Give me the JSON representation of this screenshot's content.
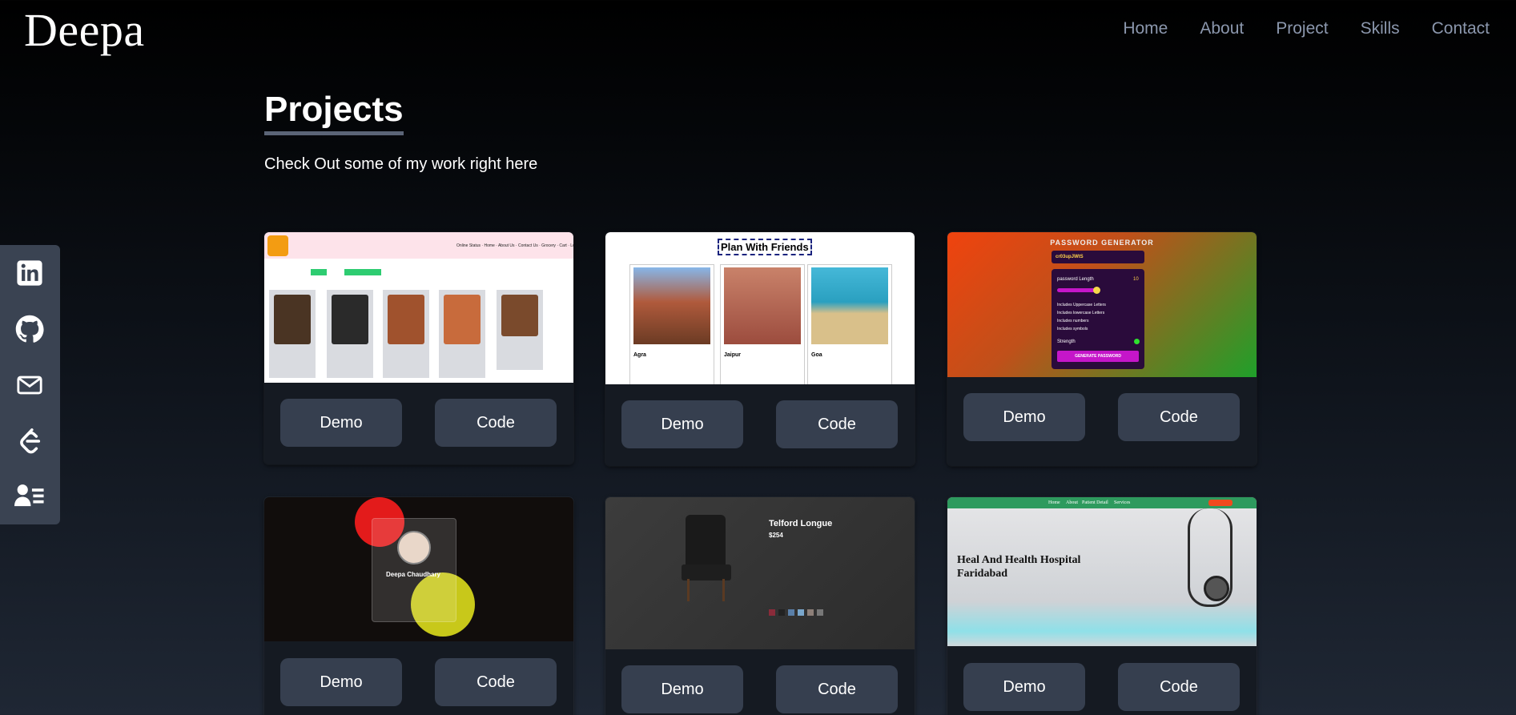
{
  "header": {
    "logo": "Deepa",
    "nav": [
      "Home",
      "About",
      "Project",
      "Skills",
      "Contact"
    ]
  },
  "page": {
    "title": "Projects",
    "subtitle": "Check Out some of my work right here"
  },
  "social_icons": [
    "linkedin-icon",
    "github-icon",
    "mail-icon",
    "leetcode-icon",
    "resume-icon"
  ],
  "projects": [
    {
      "name": "food-delivery",
      "demo": "Demo",
      "code": "Code"
    },
    {
      "name": "plan-with-friends",
      "demo": "Demo",
      "code": "Code",
      "shot_title": "Plan With Friends",
      "cities": [
        "Agra",
        "Jaipur",
        "Goa"
      ]
    },
    {
      "name": "password-generator",
      "demo": "Demo",
      "code": "Code",
      "shot_title": "PASSWORD GENERATOR",
      "password": "cr03upJWtS",
      "length_label": "password Length",
      "length_value": "10",
      "options": [
        "Includes Uppercase Letters",
        "Includes lowercase Letters",
        "Includes numbers",
        "Includes symbols"
      ],
      "strength": "Strength",
      "generate": "GENERATE PASSWORD"
    },
    {
      "name": "profile-card",
      "demo": "Demo",
      "code": "Code",
      "person": "Deepa Chaudhary"
    },
    {
      "name": "product-page",
      "demo": "Demo",
      "code": "Code",
      "product": "Telford Longue",
      "price": "$254"
    },
    {
      "name": "hospital",
      "demo": "Demo",
      "code": "Code",
      "hospital": "Heal And Health Hospital Faridabad",
      "hnav": [
        "Home",
        "About",
        "Patient Detail",
        "Services"
      ]
    }
  ],
  "colors": {
    "accent_nav": "#8b97ad",
    "button_bg": "#363f4f",
    "sidebar_bg": "#3a4352"
  }
}
